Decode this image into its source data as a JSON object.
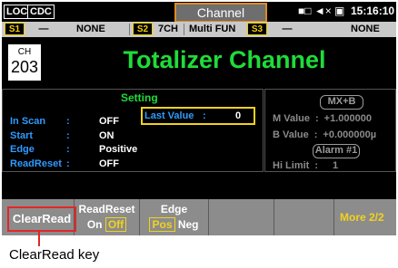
{
  "status": {
    "loc": "LOC",
    "cdc": "CDC",
    "title": "Channel",
    "icons": "■□ ◄× ▣",
    "time": "15:16:10"
  },
  "slots": [
    {
      "id": "S1",
      "value": "NONE"
    },
    {
      "id": "S2",
      "value": "7CH",
      "extra": "Multi FUN"
    },
    {
      "id": "S3",
      "value": "NONE"
    }
  ],
  "channel": {
    "label": "CH",
    "number": "203"
  },
  "page_title": "Totalizer Channel",
  "setting": {
    "title": "Setting",
    "rows": [
      {
        "key": "In Scan",
        "value": "OFF"
      },
      {
        "key": "Start",
        "value": "ON"
      },
      {
        "key": "Edge",
        "value": "Positive"
      },
      {
        "key": "ReadReset",
        "value": "OFF"
      }
    ],
    "last_value": {
      "key": "Last Value",
      "value": "0"
    }
  },
  "math": {
    "label": "MX+B",
    "m_label": "M Value",
    "m_value": "+1.000000",
    "b_label": "B Value",
    "b_value": "+0.000000µ",
    "alarm": "Alarm #1",
    "hi_label": "Hi Limit",
    "hi_value": "1"
  },
  "softkeys": {
    "clearread": "ClearRead",
    "readreset": {
      "title": "ReadReset",
      "on": "On",
      "off": "Off"
    },
    "edge": {
      "title": "Edge",
      "pos": "Pos",
      "neg": "Neg"
    },
    "more": "More 2/2"
  },
  "callout": "ClearRead key",
  "colors": {
    "accent_yellow": "#f2d21c",
    "title_green": "#1fdc3a",
    "label_blue": "#2f9bff",
    "highlight_red": "#e32626"
  }
}
